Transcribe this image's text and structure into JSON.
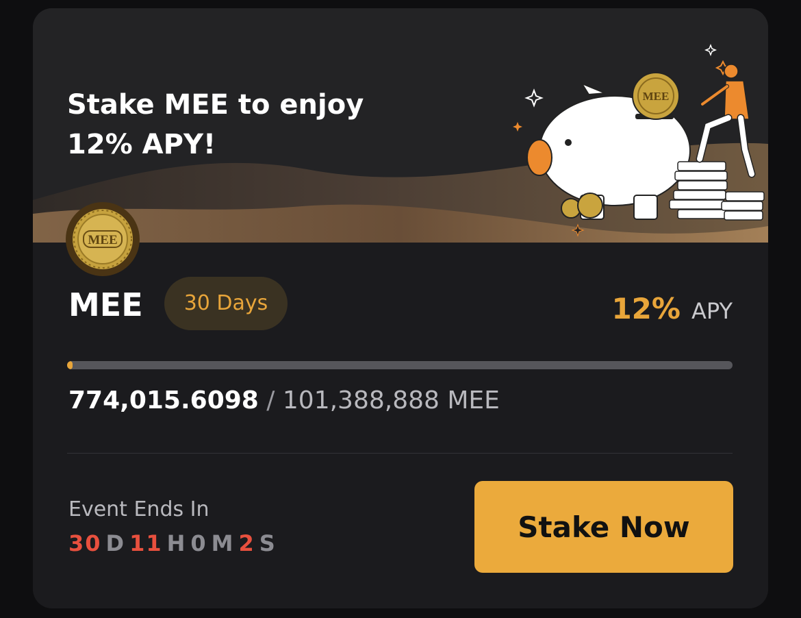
{
  "banner": {
    "headline_line1": "Stake MEE to enjoy",
    "headline_line2": "12% APY!",
    "coin_text": "MEE"
  },
  "product": {
    "token": "MEE",
    "duration": "30 Days",
    "apy_value": "12%",
    "apy_label": "APY"
  },
  "progress": {
    "staked": "774,015.6098",
    "separator": "/",
    "total": "101,388,888 MEE",
    "fraction": 0.0076
  },
  "event": {
    "label": "Event Ends In",
    "days": "30",
    "days_unit": "D",
    "hours": "11",
    "hours_unit": "H",
    "minutes": "0",
    "minutes_unit": "M",
    "seconds": "2",
    "seconds_unit": "S"
  },
  "actions": {
    "stake_label": "Stake Now"
  },
  "colors": {
    "accent": "#ebaa3c",
    "countdown_red": "#e8503e",
    "card_bg": "#1b1b1e"
  },
  "icons": [
    "mee-coin-icon",
    "piggy-bank-illustration",
    "sparkle-icon"
  ]
}
